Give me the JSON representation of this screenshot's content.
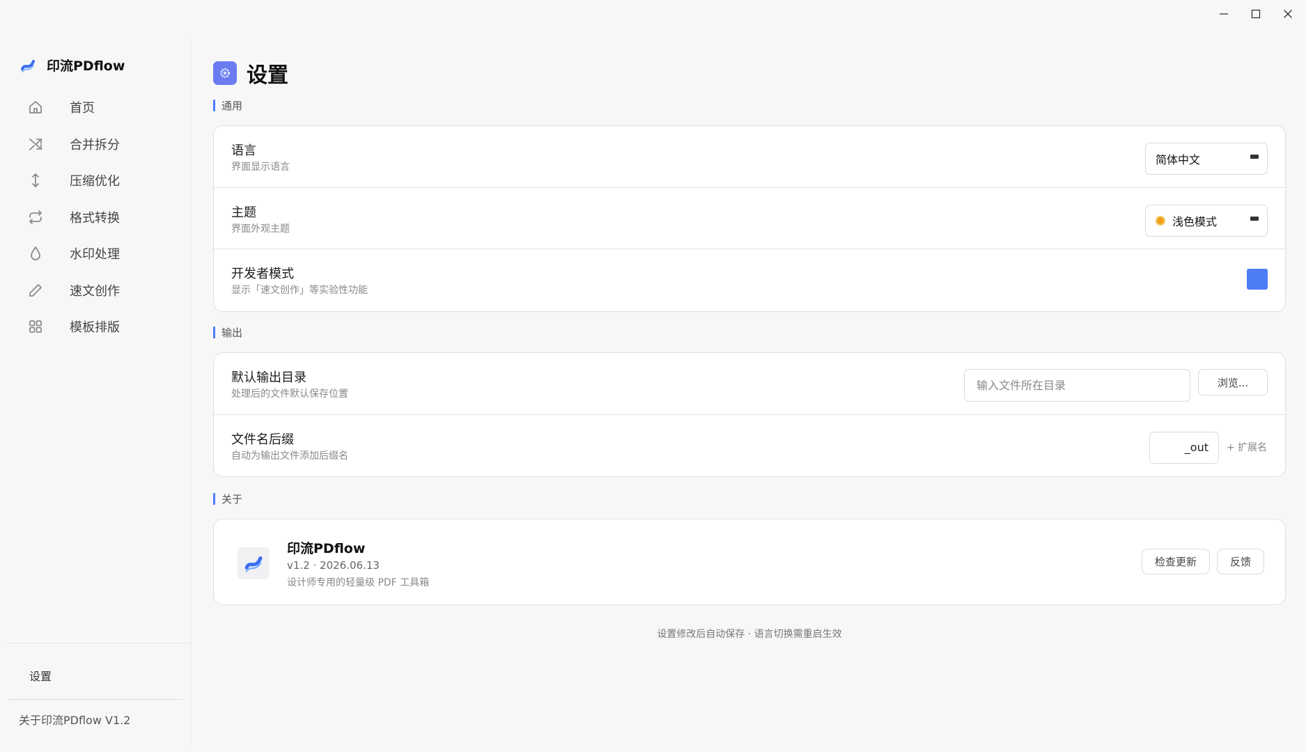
{
  "window": {
    "controls": [
      "minimize-icon",
      "maximize-icon",
      "close-icon"
    ]
  },
  "sidebar": {
    "brand": {
      "name": "印流PDflow",
      "logo_icon": "pdflow-logo-icon"
    },
    "items": [
      {
        "label": "首页",
        "icon": "home-icon"
      },
      {
        "label": "合并拆分",
        "icon": "shuffle-icon"
      },
      {
        "label": "压缩优化",
        "icon": "vertical-arrows-icon"
      },
      {
        "label": "格式转换",
        "icon": "repeat-icon"
      },
      {
        "label": "水印处理",
        "icon": "droplet-icon"
      },
      {
        "label": "速文创作",
        "icon": "pencil-icon"
      },
      {
        "label": "模板排版",
        "icon": "grid-icon"
      }
    ],
    "settings_label": "设置",
    "about_label": "关于印流PDflow  V1.2"
  },
  "page": {
    "title": "设置",
    "icon": "gear-icon",
    "accent": "#4d7cf5"
  },
  "general": {
    "section_label": "通用",
    "language": {
      "title": "语言",
      "desc": "界面显示语言",
      "value": "简体中文"
    },
    "theme": {
      "title": "主题",
      "desc": "界面外观主题",
      "value": "浅色模式",
      "icon": "sun-dot-icon"
    },
    "developer": {
      "title": "开发者模式",
      "desc": "显示「速文创作」等实验性功能",
      "enabled": true
    }
  },
  "output": {
    "section_label": "输出",
    "directory": {
      "title": "默认输出目录",
      "desc": "处理后的文件默认保存位置",
      "placeholder": "输入文件所在目录",
      "value": "",
      "browse_label": "浏览..."
    },
    "suffix": {
      "title": "文件名后缀",
      "desc": "自动为输出文件添加后缀名",
      "value": "_out",
      "ext_label": "+ 扩展名"
    }
  },
  "about": {
    "section_label": "关于",
    "app_name": "印流PDflow",
    "version": "v1.2 · 2026.06.13",
    "desc": "设计师专用的轻量级 PDF 工具箱",
    "check_update_label": "检查更新",
    "feedback_label": "反馈"
  },
  "footer_note": "设置修改后自动保存 · 语言切换需重启生效"
}
